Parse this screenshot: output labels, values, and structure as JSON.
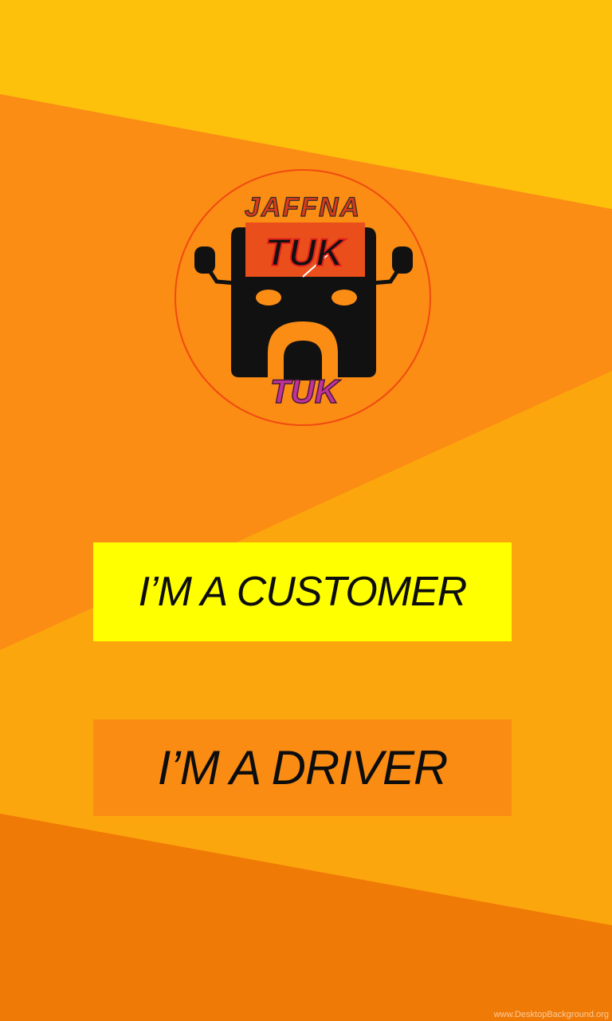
{
  "logo": {
    "top_text": "JAFFNA",
    "middle_text": "TUK",
    "bottom_text": "TUK"
  },
  "buttons": {
    "customer_label": "I’M A CUSTOMER",
    "driver_label": "I’M A DRIVER"
  },
  "watermark": "www.DesktopBackground.org",
  "colors": {
    "bg_top": "#fdc10c",
    "bg_orange": "#fb8c14",
    "bg_mid": "#fca60d",
    "bg_bottom": "#f07a06",
    "customer_button": "#ffff00",
    "driver_button": "#fa8c14",
    "logo_ring": "#f04b10"
  }
}
